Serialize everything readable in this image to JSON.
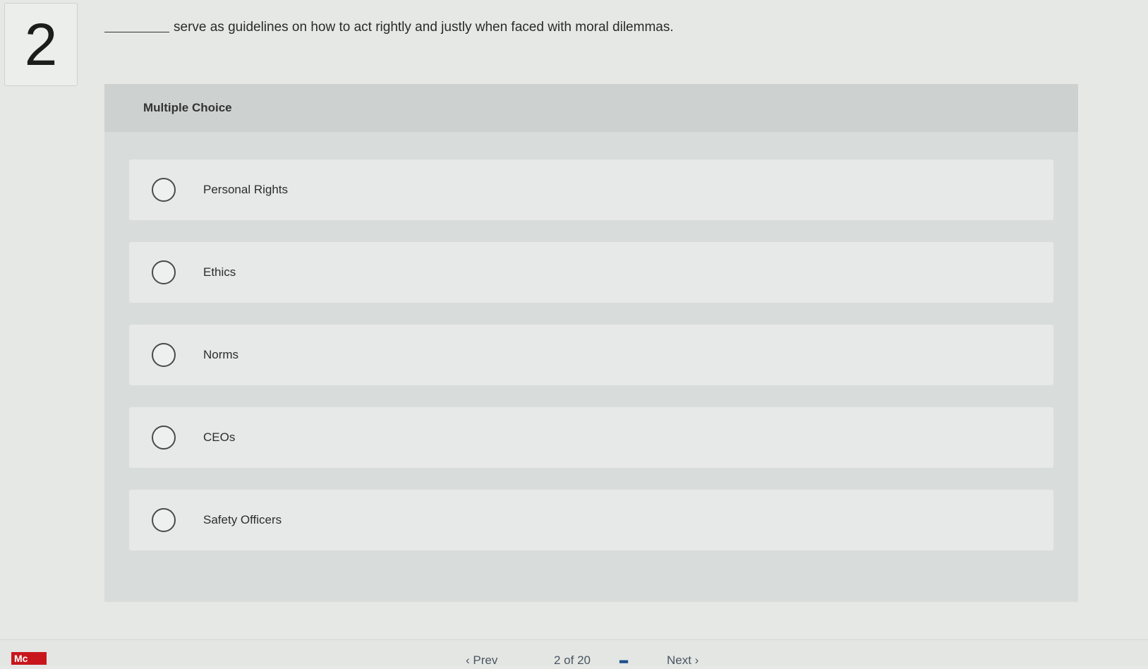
{
  "question": {
    "number": "2",
    "prompt": "serve as guidelines on how to act rightly and justly when faced with moral dilemmas."
  },
  "panel": {
    "header": "Multiple Choice",
    "options": [
      {
        "label": "Personal Rights",
        "selected": false
      },
      {
        "label": "Ethics",
        "selected": false
      },
      {
        "label": "Norms",
        "selected": false
      },
      {
        "label": "CEOs",
        "selected": false
      },
      {
        "label": "Safety Officers",
        "selected": false
      }
    ]
  },
  "footer": {
    "logo": "Mc",
    "prev_label": "‹ Prev",
    "page_indicator": "2 of 20",
    "grid_icon": "grid-icon",
    "next_label": "Next ›"
  },
  "colors": {
    "background": "#e6e8e6",
    "panel": "#d8dcdb",
    "option": "#e7e9e8",
    "logo": "#c8171c",
    "grid_icon": "#1d4f8c"
  }
}
